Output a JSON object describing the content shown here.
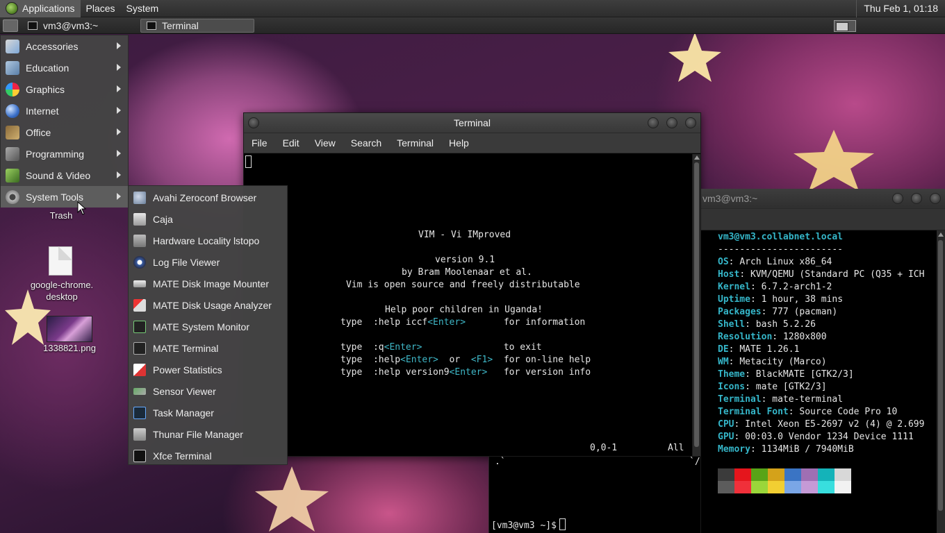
{
  "top_panel": {
    "menus": [
      "Applications",
      "Places",
      "System"
    ],
    "clock": "Thu Feb  1, 01:18"
  },
  "task_panel": {
    "tasks": [
      "vm3@vm3:~",
      "Terminal"
    ]
  },
  "apps_menu": {
    "items": [
      "Accessories",
      "Education",
      "Graphics",
      "Internet",
      "Office",
      "Programming",
      "Sound & Video",
      "System Tools"
    ]
  },
  "system_tools": {
    "items": [
      "Avahi Zeroconf Browser",
      "Caja",
      "Hardware Locality lstopo",
      "Log File Viewer",
      "MATE Disk Image Mounter",
      "MATE Disk Usage Analyzer",
      "MATE System Monitor",
      "MATE Terminal",
      "Power Statistics",
      "Sensor Viewer",
      "Task Manager",
      "Thunar File Manager",
      "Xfce Terminal"
    ]
  },
  "desktop": {
    "trash_label": "Trash",
    "chrome_label_1": "google-chrome.",
    "chrome_label_2": "desktop",
    "image_label": "1338821.png"
  },
  "vim_window": {
    "title": "Terminal",
    "menu": [
      "File",
      "Edit",
      "View",
      "Search",
      "Terminal",
      "Help"
    ],
    "splash": {
      "title": "VIM - Vi IMproved",
      "version": "version 9.1",
      "author": "by Bram Moolenaar et al.",
      "license": "Vim is open source and freely distributable",
      "help_poor": "Help poor children in Uganda!",
      "l1_pre": "type  :help iccf",
      "l1_key": "<Enter>",
      "l1_post": "       for information",
      "l2_pre": "type  :q",
      "l2_key": "<Enter>",
      "l2_post": "               to exit",
      "l3_pre": "type  :help",
      "l3_key1": "<Enter>",
      "l3_mid": "  or  ",
      "l3_key2": "<F1>",
      "l3_post": "  for on-line help",
      "l4_pre": "type  :help version9",
      "l4_key": "<Enter>",
      "l4_post": "   for version info"
    },
    "ruler_pos": "0,0-1",
    "ruler_all": "All"
  },
  "neo_window": {
    "title": "vm3@vm3:~",
    "user_host": "vm3@vm3.collabnet.local",
    "separator": "-----------------------",
    "fields": [
      {
        "key": "OS",
        "value": "Arch Linux x86_64"
      },
      {
        "key": "Host",
        "value": "KVM/QEMU (Standard PC (Q35 + ICH"
      },
      {
        "key": "Kernel",
        "value": "6.7.2-arch1-2"
      },
      {
        "key": "Uptime",
        "value": "1 hour, 38 mins"
      },
      {
        "key": "Packages",
        "value": "777 (pacman)"
      },
      {
        "key": "Shell",
        "value": "bash 5.2.26"
      },
      {
        "key": "Resolution",
        "value": "1280x800"
      },
      {
        "key": "DE",
        "value": "MATE 1.26.1"
      },
      {
        "key": "WM",
        "value": "Metacity (Marco)"
      },
      {
        "key": "Theme",
        "value": "BlackMATE [GTK2/3]"
      },
      {
        "key": "Icons",
        "value": "mate [GTK2/3]"
      },
      {
        "key": "Terminal",
        "value": "mate-terminal"
      },
      {
        "key": "Terminal Font",
        "value": "Source Code Pro 10"
      },
      {
        "key": "CPU",
        "value": "Intel Xeon E5-2697 v2 (4) @ 2.699"
      },
      {
        "key": "GPU",
        "value": "00:03.0 Vendor 1234 Device 1111"
      },
      {
        "key": "Memory",
        "value": "1134MiB / 7940MiB"
      }
    ],
    "colors_row1": [
      "#3b3b3b",
      "#e5151c",
      "#58a417",
      "#d4a21a",
      "#3a74c4",
      "#9f6fb3",
      "#14b3b9",
      "#d8d8d8"
    ],
    "colors_row2": [
      "#5c5c5c",
      "#f0303a",
      "#9ad63a",
      "#f2cf32",
      "#7aa6e6",
      "#c59ad6",
      "#38dede",
      "#f2f2f2"
    ]
  },
  "bottom_term": {
    "prompt": "[vm3@vm3 ~]$",
    "frag_left": ".`",
    "frag_right": "`/"
  }
}
